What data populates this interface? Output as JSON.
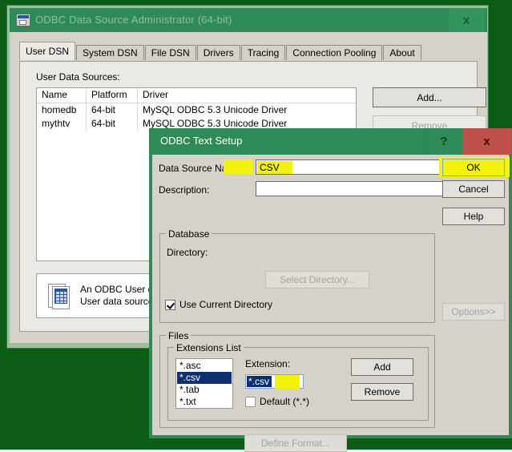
{
  "desktop": {
    "background_color": "#0d5c16"
  },
  "main_window": {
    "title": "ODBC Data Source Administrator (64-bit)",
    "icon": "odbc-window-icon",
    "close_label": "x",
    "titlebar_color": "#2e8b57",
    "tabs": [
      {
        "label": "User DSN",
        "active": true
      },
      {
        "label": "System DSN",
        "active": false
      },
      {
        "label": "File DSN",
        "active": false
      },
      {
        "label": "Drivers",
        "active": false
      },
      {
        "label": "Tracing",
        "active": false
      },
      {
        "label": "Connection Pooling",
        "active": false
      },
      {
        "label": "About",
        "active": false
      }
    ],
    "user_data_sources_label": "User Data Sources:",
    "list": {
      "columns": [
        "Name",
        "Platform",
        "Driver"
      ],
      "rows": [
        {
          "name": "homedb",
          "platform": "64-bit",
          "driver": "MySQL ODBC 5.3 Unicode Driver"
        },
        {
          "name": "mythtv",
          "platform": "64-bit",
          "driver": "MySQL ODBC 5.3 Unicode Driver"
        }
      ]
    },
    "buttons": {
      "add": "Add...",
      "remove": "Remove"
    },
    "info": {
      "icon": "data-source-icon",
      "line1": "An ODBC User data",
      "line2": "User data source is"
    }
  },
  "dialog": {
    "title": "ODBC Text Setup",
    "help_label": "?",
    "close_label": "x",
    "titlebar_color": "#2e8b57",
    "close_button_color": "#c0504a",
    "highlight_color": "#f2f20c",
    "fields": {
      "dsn_label": "Data Source Name:",
      "dsn_value": "CSV",
      "description_label": "Description:",
      "description_value": ""
    },
    "side_buttons": {
      "ok": "OK",
      "cancel": "Cancel",
      "help": "Help",
      "options": "Options>>"
    },
    "database_group": {
      "legend": "Database",
      "directory_label": "Directory:",
      "select_directory": "Select Directory...",
      "use_current_directory_label": "Use Current Directory",
      "use_current_directory_checked": true
    },
    "files_group": {
      "legend": "Files",
      "extensions_group_legend": "Extensions List",
      "extensions": [
        "*.asc",
        "*.csv",
        "*.tab",
        "*.txt"
      ],
      "selected_extension": "*.csv",
      "extension_field_label": "Extension:",
      "extension_field_value": "*.csv",
      "default_checkbox_label": "Default (*.*)",
      "default_checked": false,
      "add": "Add",
      "remove": "Remove"
    },
    "define_format": "Define Format..."
  }
}
